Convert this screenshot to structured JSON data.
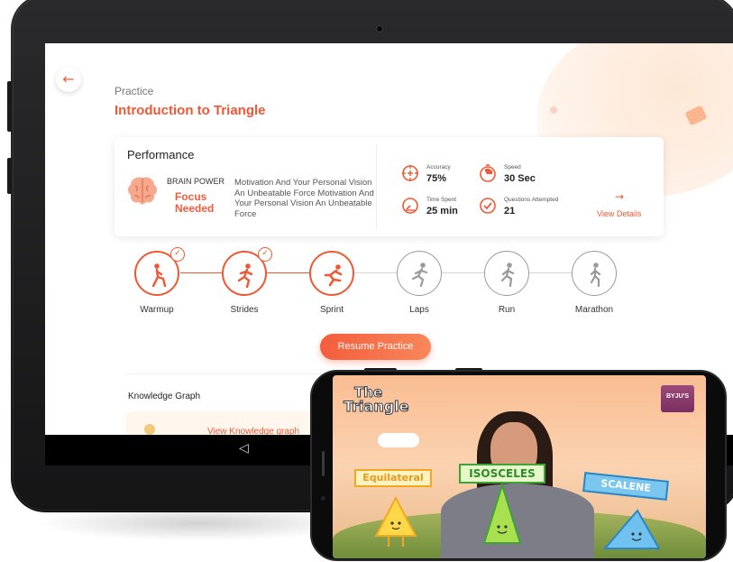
{
  "header": {
    "breadcrumb": "Practice",
    "title": "Introduction to Triangle"
  },
  "performance": {
    "title": "Performance",
    "brain_power_label": "BRAIN POWER",
    "brain_power_status": "Focus Needed",
    "description": "Motivation And Your Personal Vision An Unbeatable Force Motivation And Your Personal Vision An Unbeatable Force",
    "stats": [
      {
        "label": "Accuracy",
        "value": "75%",
        "icon": "target-icon"
      },
      {
        "label": "Speed",
        "value": "30 Sec",
        "icon": "stopwatch-icon"
      },
      {
        "label": "Time Spent",
        "value": "25 min",
        "icon": "gauge-icon"
      },
      {
        "label": "Questions Attempted",
        "value": "21",
        "icon": "check-circle-icon"
      }
    ],
    "view_details": "View Details"
  },
  "journey": {
    "steps": [
      {
        "label": "Warmup",
        "state": "done"
      },
      {
        "label": "Strides",
        "state": "done"
      },
      {
        "label": "Sprint",
        "state": "current"
      },
      {
        "label": "Laps",
        "state": "locked"
      },
      {
        "label": "Run",
        "state": "locked"
      },
      {
        "label": "Marathon",
        "state": "locked"
      }
    ]
  },
  "resume_button": "Resume Practice",
  "knowledge_graph": {
    "title": "Knowledge Graph",
    "link": "View Knowledge graph"
  },
  "video": {
    "logo_line1": "The",
    "logo_line2": "Triangle",
    "brand": "BYJU'S",
    "labels": [
      "Equilateral",
      "ISOSCELES",
      "SCALENE"
    ]
  },
  "colors": {
    "accent": "#ef5834",
    "inactive": "#9a9a9a",
    "equilateral": "#f0a820",
    "isosceles": "#3fa336",
    "scalene": "#2b86c4"
  }
}
